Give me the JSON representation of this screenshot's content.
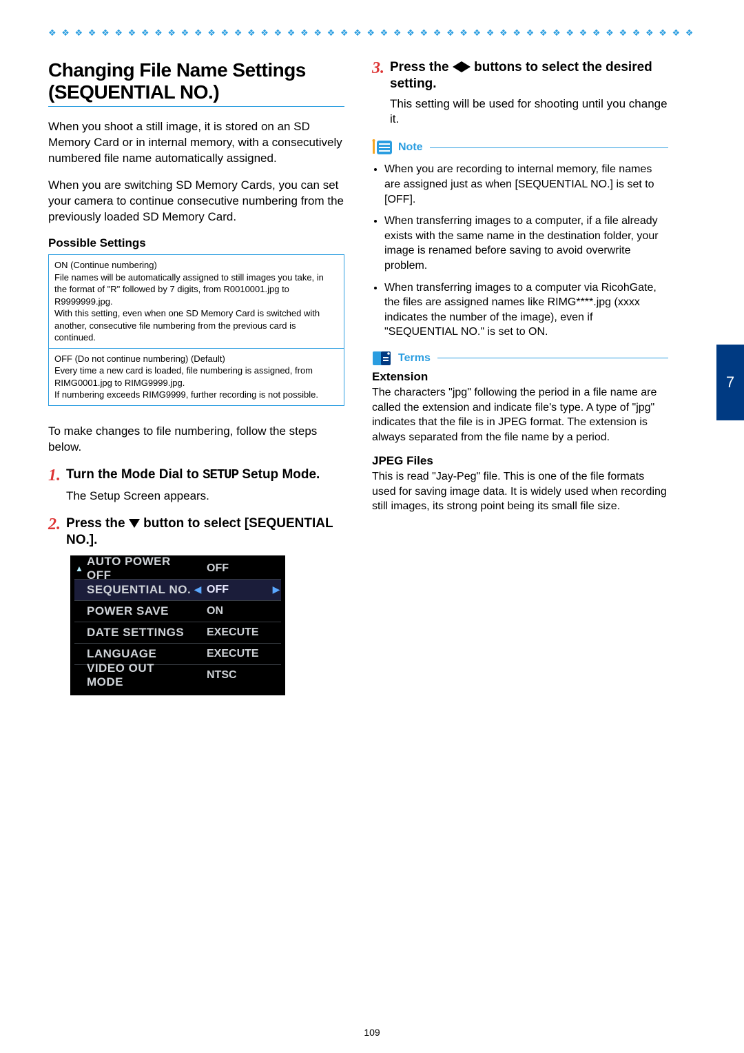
{
  "pageNumber": "109",
  "chapterTab": "7",
  "decorRow": "❖ ❖ ❖ ❖ ❖ ❖ ❖ ❖ ❖ ❖ ❖ ❖ ❖ ❖ ❖ ❖ ❖ ❖ ❖ ❖ ❖ ❖ ❖ ❖ ❖ ❖ ❖ ❖ ❖ ❖ ❖ ❖ ❖ ❖ ❖ ❖ ❖ ❖ ❖ ❖ ❖ ❖ ❖ ❖ ❖ ❖ ❖ ❖ ❖ ❖ ❖ ❖ ❖ ❖ ❖ ❖",
  "left": {
    "title": "Changing File Name Settings (SEQUENTIAL NO.)",
    "para1": "When you shoot a still image, it is stored on an SD Memory Card or in internal memory, with a consecutively numbered file name automatically assigned.",
    "para2": "When you are switching SD Memory Cards, you can set your camera to continue consecutive numbering from the previously loaded SD Memory Card.",
    "possibleSettingsHead": "Possible Settings",
    "settingOn": "ON (Continue numbering)\nFile names will be automatically assigned to still images you take, in the format of \"R\" followed by 7 digits, from R0010001.jpg to R9999999.jpg.\nWith this setting, even when one SD Memory Card is switched with another, consecutive file numbering from the previous card is continued.",
    "settingOff": "OFF (Do not continue numbering) (Default)\nEvery time a new card is loaded, file numbering is assigned, from RIMG0001.jpg to RIMG9999.jpg.\nIf numbering exceeds RIMG9999, further recording is not possible.",
    "para3": "To make changes to file numbering, follow the steps below.",
    "step1_a": "Turn the Mode Dial to ",
    "step1_setup": "SETUP",
    "step1_b": " Setup Mode.",
    "step1_body": "The Setup Screen appears.",
    "step2_a": "Press the ",
    "step2_b": " button to select [SEQUENTIAL NO.]."
  },
  "lcd": {
    "rows": [
      {
        "label": "AUTO POWER OFF",
        "value": "OFF",
        "selected": false,
        "leftArrow": false,
        "rightArrow": false
      },
      {
        "label": "SEQUENTIAL NO.",
        "value": "OFF",
        "selected": true,
        "leftArrow": true,
        "rightArrow": true
      },
      {
        "label": "POWER SAVE",
        "value": "ON",
        "selected": false,
        "leftArrow": false,
        "rightArrow": false
      },
      {
        "label": "DATE SETTINGS",
        "value": "EXECUTE",
        "selected": false,
        "leftArrow": false,
        "rightArrow": false
      },
      {
        "label": "LANGUAGE",
        "value": "EXECUTE",
        "selected": false,
        "leftArrow": false,
        "rightArrow": false
      },
      {
        "label": "VIDEO OUT MODE",
        "value": "NTSC",
        "selected": false,
        "leftArrow": false,
        "rightArrow": false
      }
    ]
  },
  "right": {
    "step3_a": "Press the ",
    "step3_b": " buttons to select the desired setting.",
    "step3_body": "This setting will be used for shooting until you change it.",
    "noteLabel": "Note",
    "notes": [
      "When you are recording to internal memory, file names are assigned just as when [SEQUENTIAL NO.] is set to [OFF].",
      "When transferring images to a computer, if a file already exists with the same name in the destination folder, your image is renamed before saving to avoid overwrite problem.",
      "When transferring images to a computer via RicohGate, the files are assigned names like RIMG****.jpg (xxxx indicates the number of the image), even if \"SEQUENTIAL NO.\" is set to ON."
    ],
    "termsLabel": "Terms",
    "terms": [
      {
        "head": "Extension",
        "body": "The characters \"jpg\" following the period in a file name are called the extension and indicate file's type. A type of \"jpg\" indicates that the file is in JPEG format. The extension is always separated from the file name by a period."
      },
      {
        "head": "JPEG Files",
        "body": "This is read \"Jay-Peg\" file. This is one of the file formats used for saving image data. It is widely used when recording still images, its strong point being its small file size."
      }
    ]
  }
}
